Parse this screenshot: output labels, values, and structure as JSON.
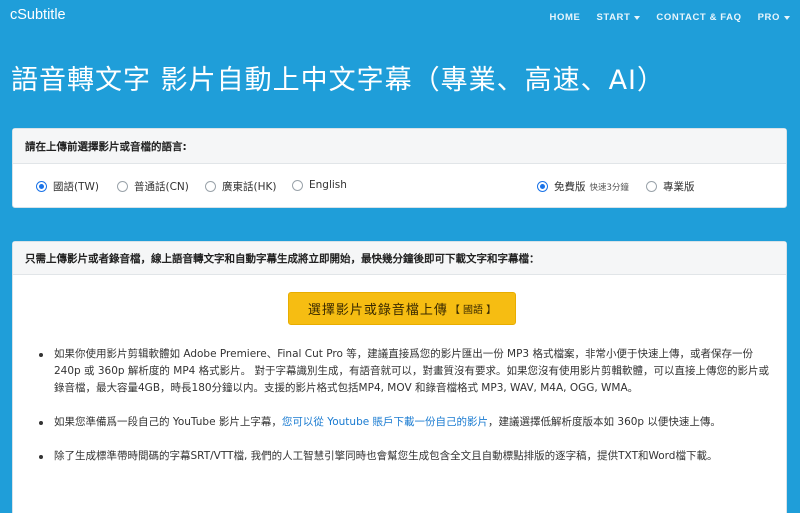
{
  "navbar": {
    "brand": "cSubtitle",
    "items": [
      {
        "label": "HOME",
        "dropdown": false
      },
      {
        "label": "START",
        "dropdown": true
      },
      {
        "label": "CONTACT & FAQ",
        "dropdown": false
      },
      {
        "label": "PRO",
        "dropdown": true
      }
    ]
  },
  "hero": {
    "title": "語音轉文字 影片自動上中文字幕（專業、高速、AI）"
  },
  "language_card": {
    "header": "請在上傳前選擇影片或音檔的語言:",
    "languages": [
      {
        "label": "國語(TW)",
        "checked": true
      },
      {
        "label": "普通話(CN)",
        "checked": false
      },
      {
        "label": "廣東話(HK)",
        "checked": false
      },
      {
        "label": "English",
        "checked": false
      }
    ],
    "plans": [
      {
        "label": "免費版",
        "note": "快速3分鐘",
        "checked": true
      },
      {
        "label": "專業版",
        "note": "",
        "checked": false
      }
    ]
  },
  "upload_card": {
    "header": "只需上傳影片或者錄音檔，線上語音轉文字和自動字幕生成將立即開始，最快幾分鐘後即可下載文字和字幕檔：",
    "button_label": "選擇影片或錄音檔上傳",
    "button_tag": "【 國語 】",
    "bullets": {
      "b1": "如果你使用影片剪辑軟體如 Adobe Premiere、Final Cut Pro 等，建議直接爲您的影片匯出一份 MP3 格式檔案，非常小便于快速上傳，或者保存一份 240p 或 360p 解析度的 MP4 格式影片。 對于字幕識別生成，有語音就可以，對畫質沒有要求。如果您沒有使用影片剪輯軟體，可以直接上傳您的影片或錄音檔，最大容量4GB，時長180分鐘以内。支援的影片格式包括MP4, MOV 和錄音檔格式 MP3, WAV, M4A, OGG, WMA。",
      "b2_before": "如果您準備爲一段自己的 YouTube 影片上字幕，",
      "b2_link": "您可以從 Youtube 賬戶下載一份自己的影片",
      "b2_after": "，建議選擇低解析度版本如 360p 以便快速上傳。",
      "b3": "除了生成標準帶時間碼的字幕SRT/VTT檔, 我們的人工智慧引擎同時也會幫您生成包含全文且自動標點排版的逐字稿，提供TXT和Word檔下載。"
    }
  }
}
